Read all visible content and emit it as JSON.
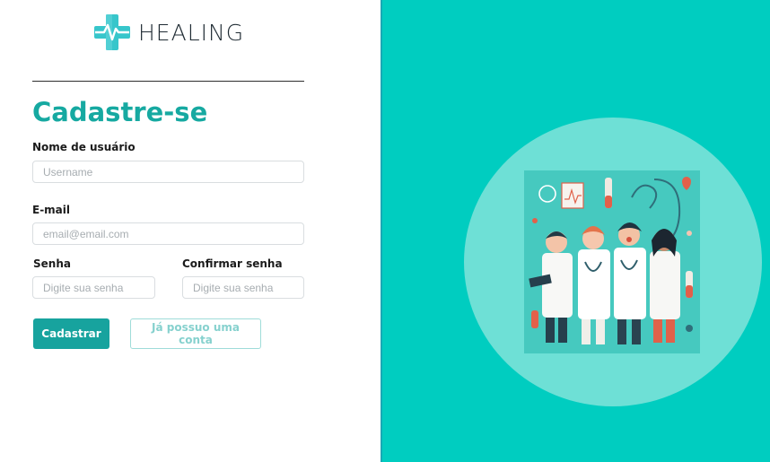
{
  "brand": {
    "name": "HEALING",
    "logo_icon": "medical-cross-heartbeat-icon",
    "accent_color": "#16a9a1"
  },
  "form": {
    "title": "Cadastre-se",
    "username": {
      "label": "Nome de usuário",
      "placeholder": "Username"
    },
    "email": {
      "label": "E-mail",
      "placeholder": "email@email.com"
    },
    "password": {
      "label": "Senha",
      "placeholder": "Digite sua senha"
    },
    "confirm_password": {
      "label": "Confirmar senha",
      "placeholder": "Digite sua senha"
    },
    "submit_label": "Cadastrar",
    "login_label": "Já possuo uma conta"
  },
  "panel": {
    "background_color": "#00cdc0",
    "illustration": "doctors-team-illustration"
  }
}
